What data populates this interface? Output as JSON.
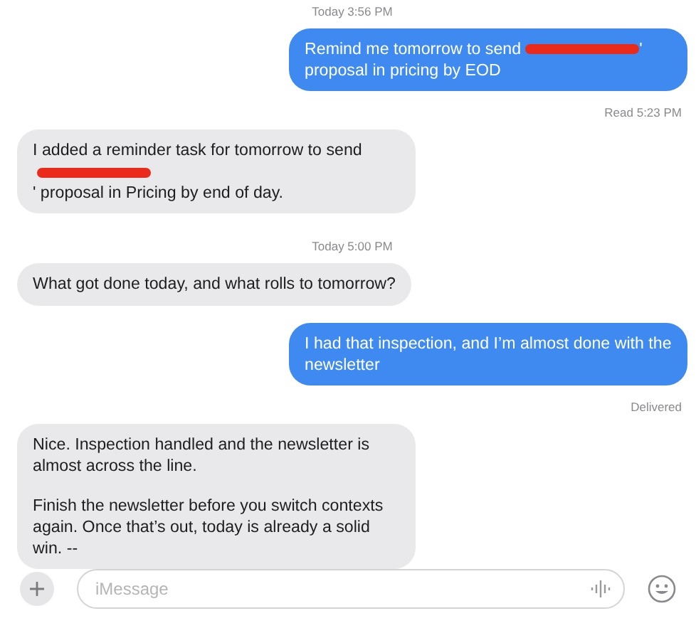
{
  "messages": [
    {
      "kind": "timestamp",
      "text": "Today 3:56 PM"
    },
    {
      "kind": "sent",
      "paragraphs": [
        [
          {
            "kind": "text",
            "text": "Remind me tomorrow to send"
          },
          {
            "kind": "redaction"
          },
          {
            "kind": "text",
            "text": "'"
          },
          {
            "kind": "text",
            "text": "proposal in pricing by EOD"
          }
        ]
      ]
    },
    {
      "kind": "status",
      "text": "Read 5:23 PM"
    },
    {
      "kind": "received",
      "paragraphs": [
        [
          {
            "kind": "text",
            "text": "I added a reminder task for tomorrow to send"
          },
          {
            "kind": "redaction"
          },
          {
            "kind": "text",
            "text": "' proposal in Pricing by end of day."
          }
        ]
      ]
    },
    {
      "kind": "timestamp",
      "text": "Today 5:00 PM"
    },
    {
      "kind": "received",
      "paragraphs": [
        [
          {
            "kind": "text",
            "text": "What got done today, and what rolls to tomorrow?"
          }
        ]
      ]
    },
    {
      "kind": "sent",
      "paragraphs": [
        [
          {
            "kind": "text",
            "text": "I had that inspection, and I’m almost done with the newsletter"
          }
        ]
      ]
    },
    {
      "kind": "status",
      "text": "Delivered"
    },
    {
      "kind": "received",
      "paragraphs": [
        [
          {
            "kind": "text",
            "text": "Nice. Inspection handled and the newsletter is almost across the line."
          }
        ],
        [
          {
            "kind": "text",
            "text": "Finish the newsletter before you switch contexts again. Once that’s out, today is already a solid win. --"
          }
        ]
      ]
    }
  ],
  "composer": {
    "placeholder": "iMessage"
  }
}
